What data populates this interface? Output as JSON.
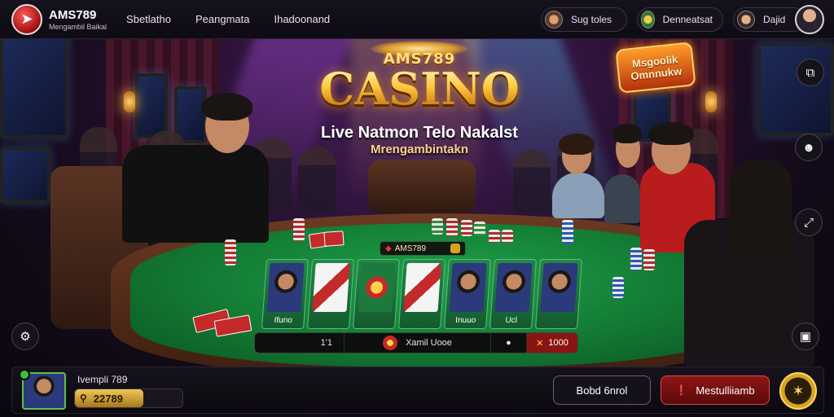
{
  "brand": {
    "name": "AMS789",
    "subtitle": "Mengambil Baikal"
  },
  "nav": [
    "Sbetlatho",
    "Peangmata",
    "Ihadoonand"
  ],
  "header_pills": [
    {
      "label": "Sug toles"
    },
    {
      "label": "Denneatsat"
    },
    {
      "label": "Dajid"
    }
  ],
  "hero": {
    "logo_small": "AMS789",
    "logo_big": "CASINO",
    "tagline_1": "Live Natmon Telo Nakalst",
    "tagline_2": "Mrengambintakn"
  },
  "promo_badge": {
    "line_1": "Msgoolik",
    "line_2": "Omnnukw"
  },
  "table": {
    "header_label": "AMS789",
    "panels": [
      {
        "label": "Ifuno"
      },
      {
        "label": ""
      },
      {
        "label": ""
      },
      {
        "label": ""
      },
      {
        "label": "Inuuo"
      },
      {
        "label": "Ucl"
      },
      {
        "label": ""
      }
    ],
    "bar": {
      "left_value": "1'1",
      "center_label": "Xamil Uooe",
      "right_value": "1000"
    }
  },
  "user": {
    "name": "Ivempli 789",
    "balance": "22789"
  },
  "buttons": {
    "outline_label": "Bobd 6nrol",
    "red_label": "Mestulliiamb"
  },
  "colors": {
    "accent_gold": "#ffd36a",
    "accent_red": "#8e1616",
    "felt_green": "#137a34",
    "online_green": "#3fbf3f"
  },
  "icons": {
    "brand": "brand-logo-icon",
    "side_right": [
      "exit-icon",
      "ghost-icon",
      "expand-icon",
      "window-icon"
    ],
    "side_left": "settings-icon",
    "balance": "search-icon",
    "red_button": "info-icon",
    "gold_button": "star-icon"
  }
}
